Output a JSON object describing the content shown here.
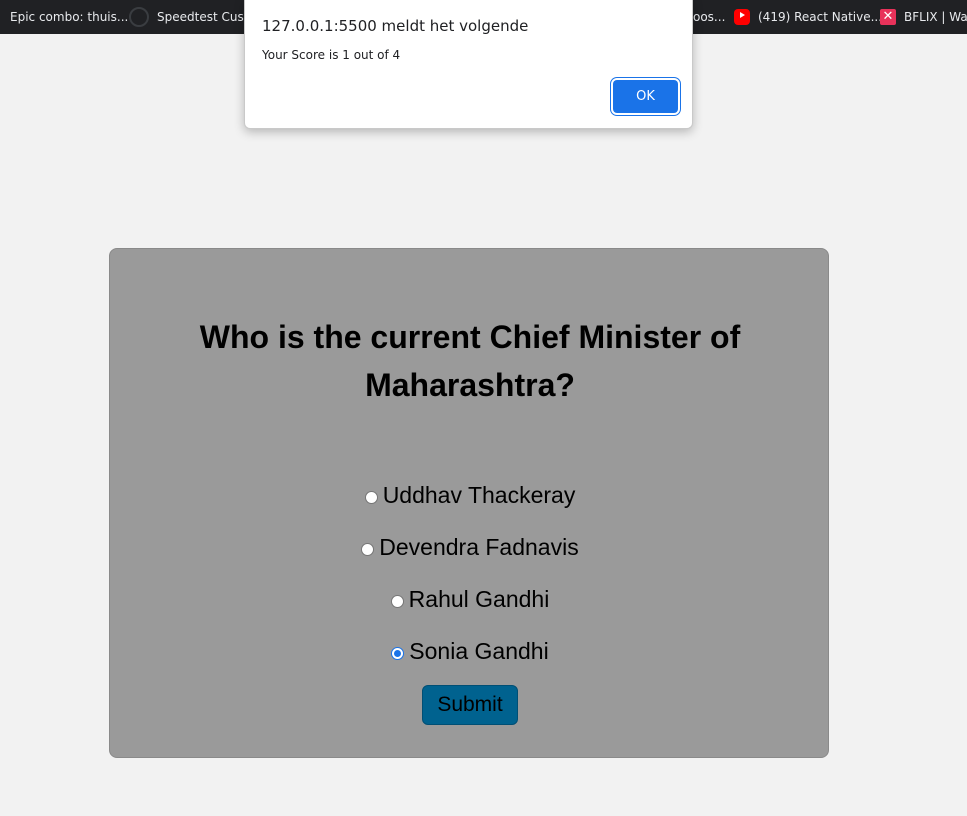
{
  "bookmarks": [
    {
      "label": "Epic combo: thuis...",
      "icon": "bookmark-icon"
    },
    {
      "label": "Speedtest Custom...",
      "icon": "speedtest-icon"
    },
    {
      "label": "oos...",
      "icon": "bookmark-icon"
    },
    {
      "label": "(419) React Native...",
      "icon": "youtube-icon"
    },
    {
      "label": "BFLIX | Watc",
      "icon": "bflix-icon"
    }
  ],
  "alert": {
    "title": "127.0.0.1:5500 meldt het volgende",
    "message": "Your Score is 1 out of 4",
    "ok_label": "OK"
  },
  "quiz": {
    "question": "Who is the current Chief Minister of Maharashtra?",
    "options": [
      {
        "label": "Uddhav Thackeray",
        "checked": false
      },
      {
        "label": "Devendra Fadnavis",
        "checked": false
      },
      {
        "label": "Rahul Gandhi",
        "checked": false
      },
      {
        "label": "Sonia Gandhi",
        "checked": true
      }
    ],
    "submit_label": "Submit"
  },
  "colors": {
    "card_background": "#9a9a9a",
    "submit_background": "#00628f",
    "dialog_button": "#1a73e8"
  }
}
